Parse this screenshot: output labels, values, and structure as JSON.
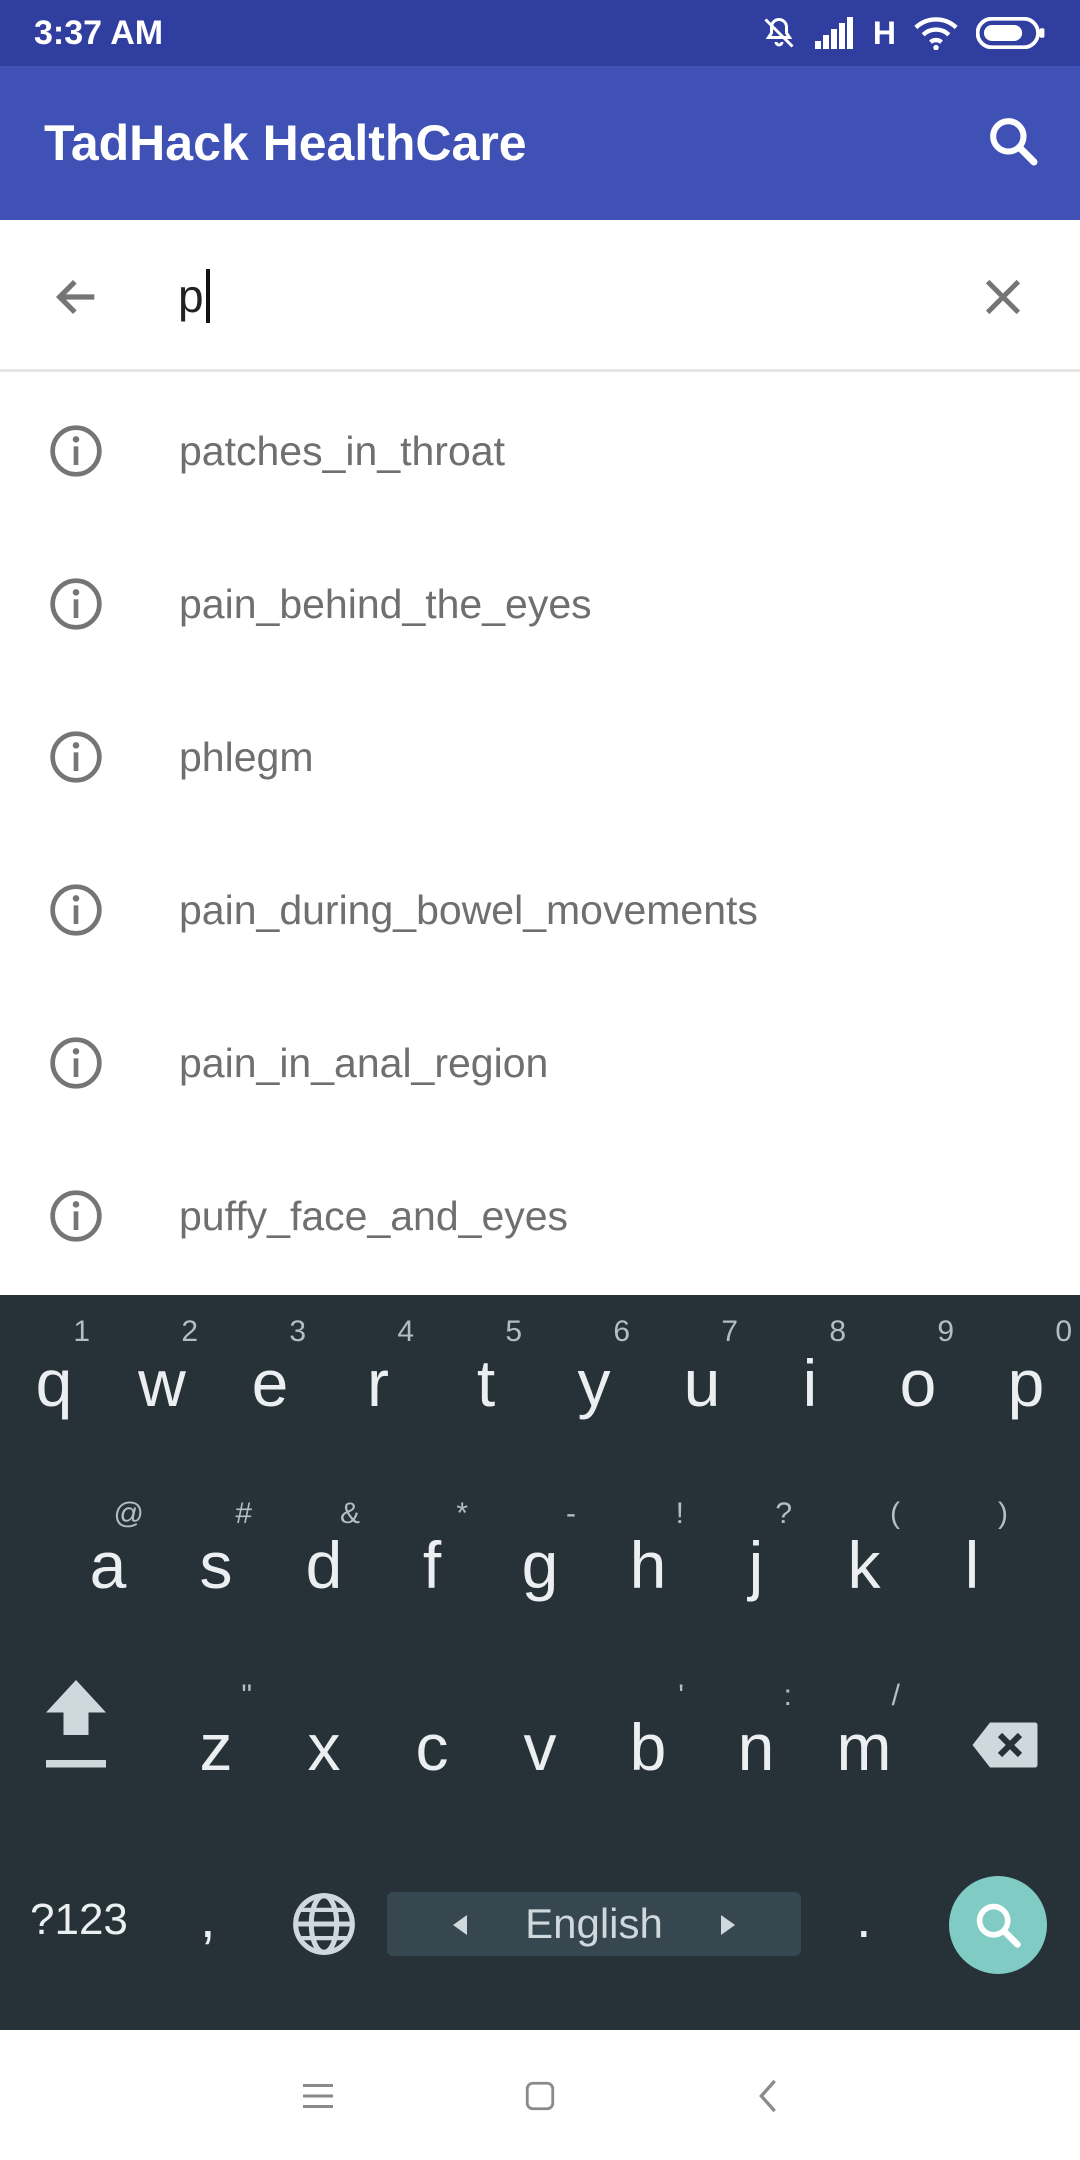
{
  "status_bar": {
    "time": "3:37 AM",
    "network_label": "H",
    "icons": [
      "mute-icon",
      "signal-icon",
      "wifi-icon",
      "battery-icon"
    ]
  },
  "app_bar": {
    "title": "TadHack HealthCare",
    "background_color": "#3f51b5",
    "status_color": "#303f9f"
  },
  "search": {
    "value": "p",
    "icons": [
      "back-arrow-icon",
      "clear-icon"
    ]
  },
  "suggestions": [
    {
      "label": "patches_in_throat",
      "icon": "info-icon"
    },
    {
      "label": "pain_behind_the_eyes",
      "icon": "info-icon"
    },
    {
      "label": "phlegm",
      "icon": "info-icon"
    },
    {
      "label": "pain_during_bowel_movements",
      "icon": "info-icon"
    },
    {
      "label": "pain_in_anal_region",
      "icon": "info-icon"
    },
    {
      "label": "puffy_face_and_eyes",
      "icon": "info-icon"
    }
  ],
  "keyboard": {
    "row1": [
      {
        "key": "q",
        "hint": "1"
      },
      {
        "key": "w",
        "hint": "2"
      },
      {
        "key": "e",
        "hint": "3"
      },
      {
        "key": "r",
        "hint": "4"
      },
      {
        "key": "t",
        "hint": "5"
      },
      {
        "key": "y",
        "hint": "6"
      },
      {
        "key": "u",
        "hint": "7"
      },
      {
        "key": "i",
        "hint": "8"
      },
      {
        "key": "o",
        "hint": "9"
      },
      {
        "key": "p",
        "hint": "0"
      }
    ],
    "row2": [
      {
        "key": "a",
        "hint": "@"
      },
      {
        "key": "s",
        "hint": "#"
      },
      {
        "key": "d",
        "hint": "&"
      },
      {
        "key": "f",
        "hint": "*"
      },
      {
        "key": "g",
        "hint": "-"
      },
      {
        "key": "h",
        "hint": "!"
      },
      {
        "key": "j",
        "hint": "?"
      },
      {
        "key": "k",
        "hint": "("
      },
      {
        "key": "l",
        "hint": ")"
      }
    ],
    "row3": [
      {
        "key": "z",
        "hint": "\""
      },
      {
        "key": "x",
        "hint": ""
      },
      {
        "key": "c",
        "hint": ""
      },
      {
        "key": "v",
        "hint": ""
      },
      {
        "key": "b",
        "hint": "'"
      },
      {
        "key": "n",
        "hint": ":"
      },
      {
        "key": "m",
        "hint": "/"
      }
    ],
    "symbols_label": "?123",
    "comma_label": ",",
    "space_label": "English",
    "period_label": ".",
    "background_color": "#263238",
    "action_color": "#80cbc4"
  },
  "nav_bar": {
    "icons": [
      "menu-icon",
      "home-icon",
      "back-icon"
    ]
  }
}
